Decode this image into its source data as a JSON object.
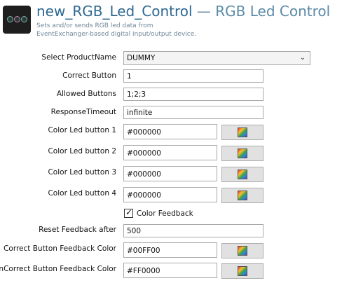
{
  "header": {
    "app_name": "new_RGB_Led_Control",
    "separator": "—",
    "subtitle": "RGB Led Control",
    "description_line1": "Sets and/or sends RGB led data from",
    "description_line2": "EventExchanger-based digital input/output device."
  },
  "form": {
    "product": {
      "label": "Select ProductName",
      "value": "DUMMY"
    },
    "correct_button": {
      "label": "Correct Button",
      "value": "1"
    },
    "allowed_buttons": {
      "label": "Allowed Buttons",
      "value": "1;2;3"
    },
    "response_timeout": {
      "label": "ResponseTimeout",
      "value": "infinite"
    },
    "led1": {
      "label": "Color Led button 1",
      "value": "#000000"
    },
    "led2": {
      "label": "Color Led button 2",
      "value": "#000000"
    },
    "led3": {
      "label": "Color Led button 3",
      "value": "#000000"
    },
    "led4": {
      "label": "Color Led button 4",
      "value": "#000000"
    },
    "color_feedback": {
      "label": "Color Feedback",
      "checked": true
    },
    "reset_feedback": {
      "label": "Reset Feedback after",
      "value": "500"
    },
    "correct_feedback_color": {
      "label": "Correct Button Feedback Color",
      "value": "#00FF00"
    },
    "incorrect_feedback_color": {
      "label": "InCorrect Button Feedback Color",
      "value": "#FF0000"
    }
  },
  "icons": {
    "logo": "led-device-icon",
    "color_picker": "color-picker-icon",
    "dropdown": "chevron-down-icon",
    "checkmark": "checkmark-icon"
  }
}
